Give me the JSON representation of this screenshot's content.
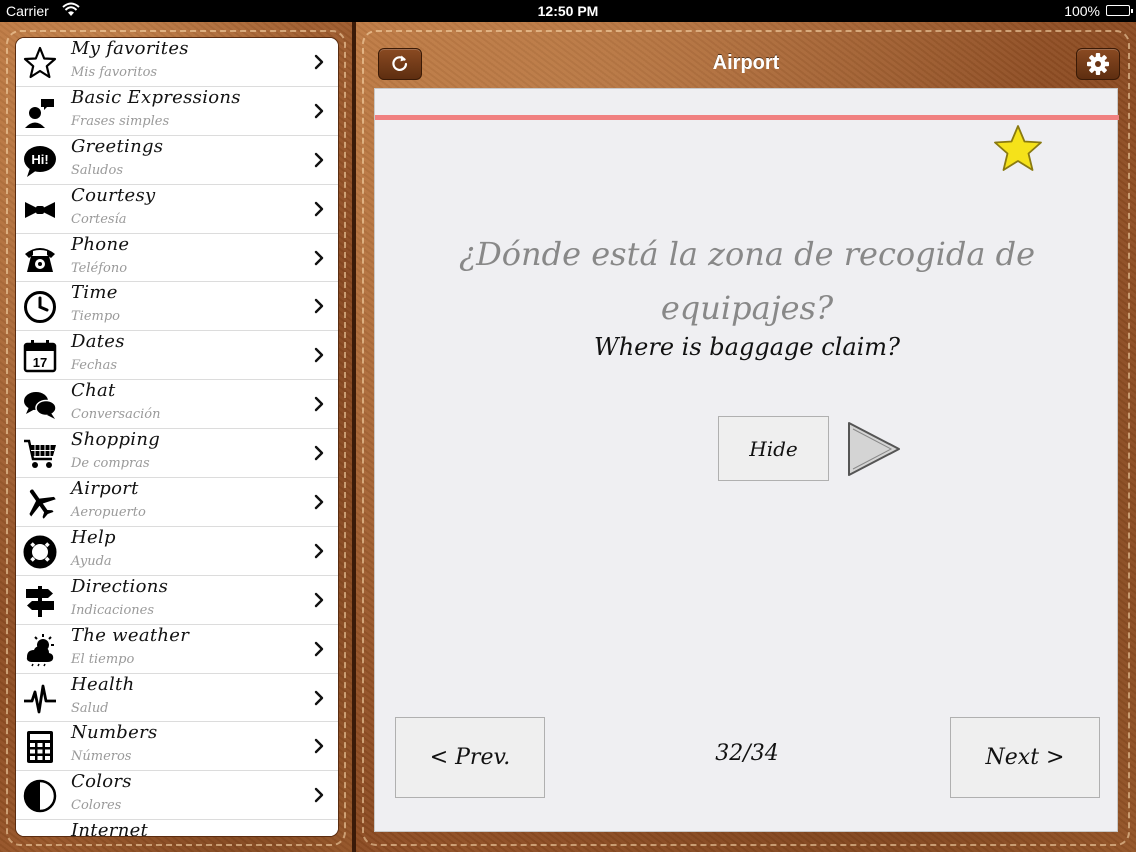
{
  "status_bar": {
    "carrier": "Carrier",
    "time": "12:50 PM",
    "battery": "100%"
  },
  "categories": [
    {
      "title": "My favorites",
      "subtitle": "Mis favoritos",
      "icon": "star-outline-icon"
    },
    {
      "title": "Basic Expressions",
      "subtitle": "Frases simples",
      "icon": "speaking-person-icon"
    },
    {
      "title": "Greetings",
      "subtitle": "Saludos",
      "icon": "hi-bubble-icon",
      "icon_text": "Hi!"
    },
    {
      "title": "Courtesy",
      "subtitle": "Cortesía",
      "icon": "bow-tie-icon"
    },
    {
      "title": "Phone",
      "subtitle": "Teléfono",
      "icon": "telephone-icon"
    },
    {
      "title": "Time",
      "subtitle": "Tiempo",
      "icon": "clock-icon"
    },
    {
      "title": "Dates",
      "subtitle": "Fechas",
      "icon": "calendar-icon",
      "icon_text": "17"
    },
    {
      "title": "Chat",
      "subtitle": "Conversación",
      "icon": "chat-bubbles-icon"
    },
    {
      "title": "Shopping",
      "subtitle": "De compras",
      "icon": "shopping-cart-icon"
    },
    {
      "title": "Airport",
      "subtitle": "Aeropuerto",
      "icon": "airplane-icon"
    },
    {
      "title": "Help",
      "subtitle": "Ayuda",
      "icon": "lifebuoy-icon"
    },
    {
      "title": "Directions",
      "subtitle": "Indicaciones",
      "icon": "signpost-icon"
    },
    {
      "title": "The weather",
      "subtitle": "El tiempo",
      "icon": "weather-icon"
    },
    {
      "title": "Health",
      "subtitle": "Salud",
      "icon": "heartbeat-icon"
    },
    {
      "title": "Numbers",
      "subtitle": "Números",
      "icon": "calculator-icon"
    },
    {
      "title": "Colors",
      "subtitle": "Colores",
      "icon": "contrast-icon"
    },
    {
      "title": "Internet",
      "subtitle": "",
      "icon": "laptop-icon"
    }
  ],
  "header": {
    "title": "Airport",
    "refresh_icon": "refresh-icon",
    "settings_icon": "gear-icon"
  },
  "card": {
    "phrase_es": "¿Dónde está la zona de recogida de equipajes?",
    "phrase_en": "Where is baggage claim?",
    "hide_label": "Hide",
    "prev_label": "< Prev.",
    "next_label": "Next >",
    "counter": "32/34",
    "favorite_color": "#f5e21a",
    "accent_line_color": "#f08080"
  }
}
